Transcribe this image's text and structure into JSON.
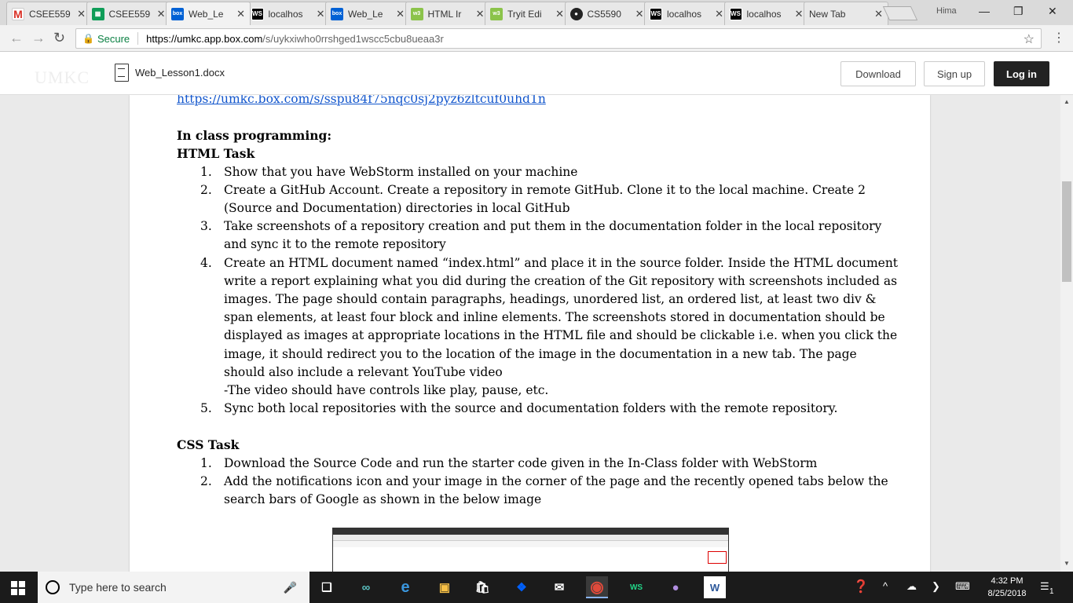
{
  "browser": {
    "tabs": [
      {
        "label": "CSEE559",
        "icon": "gmail-icon"
      },
      {
        "label": "CSEE559",
        "icon": "sheets-icon"
      },
      {
        "label": "Web_Le",
        "icon": "box-icon",
        "active": true
      },
      {
        "label": "localhos",
        "icon": "webstorm-icon"
      },
      {
        "label": "Web_Le",
        "icon": "box-icon"
      },
      {
        "label": "HTML Ir",
        "icon": "w3schools-icon"
      },
      {
        "label": "Tryit Edi",
        "icon": "w3schools-icon"
      },
      {
        "label": "CS5590",
        "icon": "github-icon"
      },
      {
        "label": "localhos",
        "icon": "webstorm-icon"
      },
      {
        "label": "localhos",
        "icon": "webstorm-icon"
      },
      {
        "label": "New Tab",
        "icon": ""
      }
    ],
    "profile_name": "Hima",
    "secure_label": "Secure",
    "url_host": "https://umkc.app.box.com",
    "url_path": "/s/uykxiwho0rrshged1wscc5cbu8ueaa3r"
  },
  "box": {
    "logo": "UMKC",
    "file_name": "Web_Lesson1.docx",
    "download_label": "Download",
    "signup_label": "Sign up",
    "login_label": "Log in"
  },
  "document": {
    "top_link": "https://umkc.box.com/s/sspu84f75nqc0sj2pyz6zltcuf0uhd1n",
    "heading_inclass": "In class programming:",
    "heading_html": "HTML Task",
    "html_tasks": [
      {
        "num": "1.",
        "text": "Show that you have WebStorm installed on your machine"
      },
      {
        "num": "2.",
        "text": "Create a GitHub Account. Create a repository in remote GitHub. Clone it to the local machine. Create 2 (Source and Documentation) directories in local GitHub"
      },
      {
        "num": "3.",
        "text": "Take screenshots of a repository creation and put them in the documentation folder in the local repository and sync it to the remote repository"
      },
      {
        "num": "4.",
        "text": "Create an HTML document named “index.html” and place it in the source folder. Inside the HTML document write a report explaining what you did during the creation of the Git repository with screenshots included as images. The page should contain paragraphs, headings, unordered list, an ordered list, at least two div & span elements, at least four block and inline elements.  The screenshots stored in documentation should be displayed as images at appropriate locations in the HTML file and should be clickable i.e. when you click the image, it should redirect you to the location of the image in the documentation in a new tab. The page should also include a relevant YouTube video",
        "extra": "-The video should have controls like play, pause, etc."
      },
      {
        "num": "5.",
        "text": "Sync both local repositories with the source and documentation folders with the remote repository."
      }
    ],
    "heading_css": "CSS Task",
    "css_tasks": [
      {
        "num": "1.",
        "text": "Download the Source Code and run the starter code given in the In-Class folder with WebStorm"
      },
      {
        "num": "2.",
        "text": "Add the notifications icon and your image in the corner of the page and the recently opened tabs below the search bars of Google as shown in the below image"
      }
    ]
  },
  "taskbar": {
    "search_placeholder": "Type here to search",
    "time": "4:32 PM",
    "date": "8/25/2018",
    "notification_count": "1"
  }
}
